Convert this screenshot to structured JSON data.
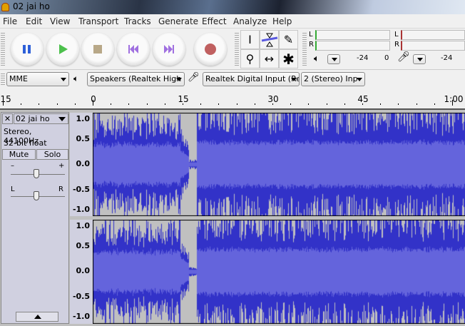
{
  "window": {
    "title": "02 jai ho"
  },
  "menu": [
    "File",
    "Edit",
    "View",
    "Transport",
    "Tracks",
    "Generate",
    "Effect",
    "Analyze",
    "Help"
  ],
  "transport": {
    "buttons": [
      "pause",
      "play",
      "stop",
      "skip-to-start",
      "skip-to-end",
      "record"
    ]
  },
  "tools": [
    "selection",
    "envelope",
    "draw",
    "zoom",
    "time-shift",
    "multi"
  ],
  "meters": {
    "play": {
      "l": "L",
      "r": "R",
      "scale": [
        "-24",
        "0"
      ]
    },
    "record": {
      "l": "L",
      "r": "R",
      "scale": [
        "-24"
      ]
    }
  },
  "devices": {
    "host": "MME",
    "output": "Speakers (Realtek High",
    "input": "Realtek Digital Input (Re",
    "channels": "2 (Stereo) Inp"
  },
  "ruler": {
    "labels": [
      "-15",
      "0",
      "15",
      "30",
      "45",
      "1:00"
    ]
  },
  "track": {
    "name": "02 jai ho",
    "format": "Stereo, 44100Hz",
    "bits": "32-bit float",
    "mute": "Mute",
    "solo": "Solo",
    "gain_minus": "–",
    "gain_plus": "+",
    "pan_l": "L",
    "pan_r": "R",
    "gain": 0.5,
    "pan": 0.5
  },
  "yaxis": [
    "1.0",
    "0.5",
    "0.0",
    "-0.5",
    "-1.0"
  ],
  "colors": {
    "wave": "#3232c8",
    "rms": "#6464dc",
    "bg": "#c0c0c0"
  }
}
